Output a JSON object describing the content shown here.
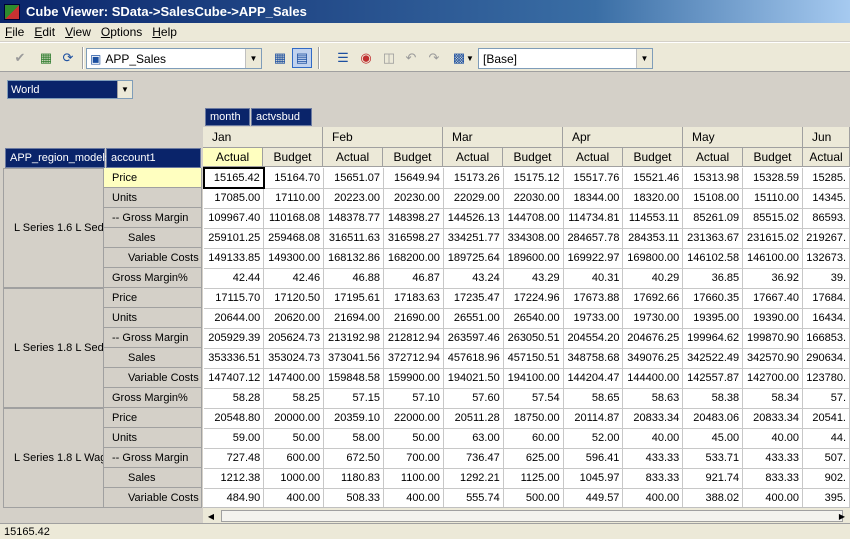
{
  "window": {
    "title": "Cube Viewer: SData->SalesCube->APP_Sales"
  },
  "menu": [
    "File",
    "Edit",
    "View",
    "Options",
    "Help"
  ],
  "toolbar": {
    "view_select": "APP_Sales",
    "subset_select": "[Base]",
    "icons": [
      "check-icon",
      "save-icon",
      "refresh-icon",
      "cube-icon",
      "properties-icon",
      "export-icon",
      "stop-icon",
      "copy-icon",
      "undo-icon",
      "redo-icon",
      "dimension-icon",
      "dropdown-arrow-icon"
    ]
  },
  "title_dimension": {
    "value": "World"
  },
  "column_dims": [
    "month",
    "actvsbud"
  ],
  "row_dims": [
    "APP_region_models",
    "account1"
  ],
  "months": [
    "Jan",
    "Feb",
    "Mar",
    "Apr",
    "May",
    "Jun"
  ],
  "subcols": [
    "Actual",
    "Budget"
  ],
  "regions": [
    "L Series 1.6 L Sedan",
    "L Series 1.8 L Sedan",
    "L Series 1.8 L Wagon"
  ],
  "rows": [
    {
      "account": "Price",
      "indent": 1,
      "values": [
        "15165.42",
        "15164.70",
        "15651.07",
        "15649.94",
        "15173.26",
        "15175.12",
        "15517.76",
        "15521.46",
        "15313.98",
        "15328.59",
        "15285."
      ]
    },
    {
      "account": "Units",
      "indent": 1,
      "values": [
        "17085.00",
        "17110.00",
        "20223.00",
        "20230.00",
        "22029.00",
        "22030.00",
        "18344.00",
        "18320.00",
        "15108.00",
        "15110.00",
        "14345."
      ]
    },
    {
      "account": "-- Gross Margin",
      "indent": 0,
      "values": [
        "109967.40",
        "110168.08",
        "148378.77",
        "148398.27",
        "144526.13",
        "144708.00",
        "114734.81",
        "114553.11",
        "85261.09",
        "85515.02",
        "86593."
      ]
    },
    {
      "account": "Sales",
      "indent": 2,
      "values": [
        "259101.25",
        "259468.08",
        "316511.63",
        "316598.27",
        "334251.77",
        "334308.00",
        "284657.78",
        "284353.11",
        "231363.67",
        "231615.02",
        "219267."
      ]
    },
    {
      "account": "Variable Costs",
      "indent": 2,
      "values": [
        "149133.85",
        "149300.00",
        "168132.86",
        "168200.00",
        "189725.64",
        "189600.00",
        "169922.97",
        "169800.00",
        "146102.58",
        "146100.00",
        "132673."
      ]
    },
    {
      "account": "Gross Margin%",
      "indent": 0,
      "values": [
        "42.44",
        "42.46",
        "46.88",
        "46.87",
        "43.24",
        "43.29",
        "40.31",
        "40.29",
        "36.85",
        "36.92",
        "39."
      ]
    },
    {
      "account": "Price",
      "indent": 1,
      "values": [
        "17115.70",
        "17120.50",
        "17195.61",
        "17183.63",
        "17235.47",
        "17224.96",
        "17673.88",
        "17692.66",
        "17660.35",
        "17667.40",
        "17684."
      ]
    },
    {
      "account": "Units",
      "indent": 1,
      "values": [
        "20644.00",
        "20620.00",
        "21694.00",
        "21690.00",
        "26551.00",
        "26540.00",
        "19733.00",
        "19730.00",
        "19395.00",
        "19390.00",
        "16434."
      ]
    },
    {
      "account": "-- Gross Margin",
      "indent": 0,
      "values": [
        "205929.39",
        "205624.73",
        "213192.98",
        "212812.94",
        "263597.46",
        "263050.51",
        "204554.20",
        "204676.25",
        "199964.62",
        "199870.90",
        "166853."
      ]
    },
    {
      "account": "Sales",
      "indent": 2,
      "values": [
        "353336.51",
        "353024.73",
        "373041.56",
        "372712.94",
        "457618.96",
        "457150.51",
        "348758.68",
        "349076.25",
        "342522.49",
        "342570.90",
        "290634."
      ]
    },
    {
      "account": "Variable Costs",
      "indent": 2,
      "values": [
        "147407.12",
        "147400.00",
        "159848.58",
        "159900.00",
        "194021.50",
        "194100.00",
        "144204.47",
        "144400.00",
        "142557.87",
        "142700.00",
        "123780."
      ]
    },
    {
      "account": "Gross Margin%",
      "indent": 0,
      "values": [
        "58.28",
        "58.25",
        "57.15",
        "57.10",
        "57.60",
        "57.54",
        "58.65",
        "58.63",
        "58.38",
        "58.34",
        "57."
      ]
    },
    {
      "account": "Price",
      "indent": 1,
      "values": [
        "20548.80",
        "20000.00",
        "20359.10",
        "22000.00",
        "20511.28",
        "18750.00",
        "20114.87",
        "20833.34",
        "20483.06",
        "20833.34",
        "20541."
      ]
    },
    {
      "account": "Units",
      "indent": 1,
      "values": [
        "59.00",
        "50.00",
        "58.00",
        "50.00",
        "63.00",
        "60.00",
        "52.00",
        "40.00",
        "45.00",
        "40.00",
        "44."
      ]
    },
    {
      "account": "-- Gross Margin",
      "indent": 0,
      "values": [
        "727.48",
        "600.00",
        "672.50",
        "700.00",
        "736.47",
        "625.00",
        "596.41",
        "433.33",
        "533.71",
        "433.33",
        "507."
      ]
    },
    {
      "account": "Sales",
      "indent": 2,
      "values": [
        "1212.38",
        "1000.00",
        "1180.83",
        "1100.00",
        "1292.21",
        "1125.00",
        "1045.97",
        "833.33",
        "921.74",
        "833.33",
        "902."
      ]
    },
    {
      "account": "Variable Costs",
      "indent": 2,
      "values": [
        "484.90",
        "400.00",
        "508.33",
        "400.00",
        "555.74",
        "500.00",
        "449.57",
        "400.00",
        "388.02",
        "400.00",
        "395."
      ]
    }
  ],
  "status": {
    "text": "15165.42"
  }
}
